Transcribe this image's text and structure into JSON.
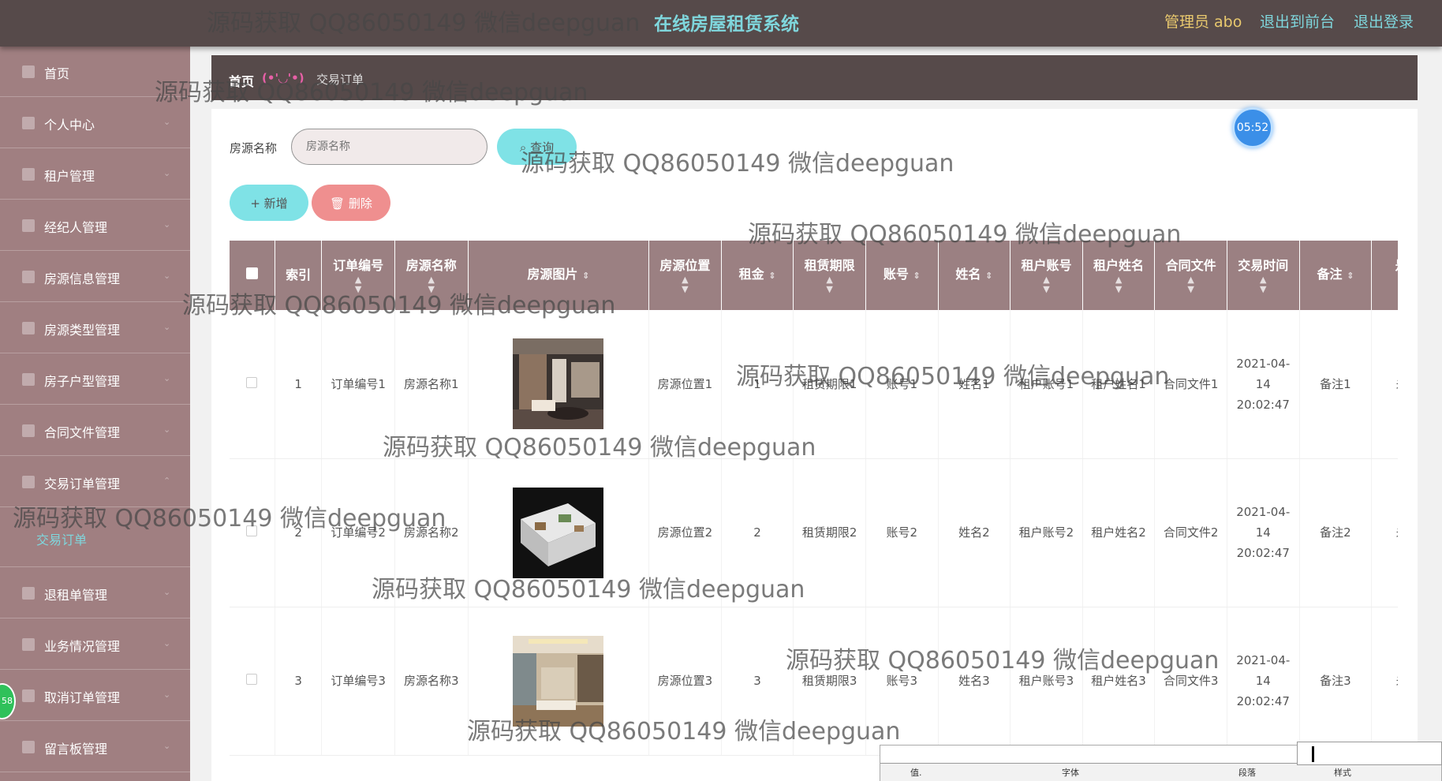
{
  "topbar": {
    "title": "在线房屋租赁系统",
    "admin": "管理员 abo",
    "front": "退出到前台",
    "logout": "退出登录"
  },
  "sidebar": {
    "items": [
      {
        "label": "首页",
        "icon": "home-icon"
      },
      {
        "label": "个人中心",
        "icon": "user-icon"
      },
      {
        "label": "租户管理",
        "icon": "tenant-icon"
      },
      {
        "label": "经纪人管理",
        "icon": "agent-icon"
      },
      {
        "label": "房源信息管理",
        "icon": "house-icon"
      },
      {
        "label": "房源类型管理",
        "icon": "type-icon"
      },
      {
        "label": "房子户型管理",
        "icon": "layout-icon"
      },
      {
        "label": "合同文件管理",
        "icon": "contract-icon"
      },
      {
        "label": "交易订单管理",
        "icon": "order-icon"
      },
      {
        "label": "退租单管理",
        "icon": "flag-icon"
      },
      {
        "label": "业务情况管理",
        "icon": "grid-icon"
      },
      {
        "label": "取消订单管理",
        "icon": "cancel-icon"
      },
      {
        "label": "留言板管理",
        "icon": "message-icon"
      }
    ],
    "active_sub": "交易订单"
  },
  "breadcrumb": {
    "home": "首页",
    "separator": "(•'◡'•)",
    "current": "交易订单"
  },
  "search": {
    "label": "房源名称",
    "placeholder": "房源名称",
    "query": "查询"
  },
  "actions": {
    "add": "+ 新增",
    "delete": "删除"
  },
  "timer": "05:52",
  "table": {
    "headers": [
      "索引",
      "订单编号",
      "房源名称",
      "房源图片",
      "房源位置",
      "租金",
      "租赁期限",
      "账号",
      "姓名",
      "租户账号",
      "租户姓名",
      "合同文件",
      "交易时间",
      "备注",
      "是否"
    ],
    "rows": [
      {
        "index": "1",
        "order_no": "订单编号1",
        "name": "房源名称1",
        "location": "房源位置1",
        "rent": "1",
        "term": "租赁期限1",
        "account": "账号1",
        "person": "姓名1",
        "tenant_account": "租户账号1",
        "tenant_name": "租户姓名1",
        "contract": "合同文件1",
        "time": "2021-04-14 20:02:47",
        "remark": "备注1",
        "status": "未支"
      },
      {
        "index": "2",
        "order_no": "订单编号2",
        "name": "房源名称2",
        "location": "房源位置2",
        "rent": "2",
        "term": "租赁期限2",
        "account": "账号2",
        "person": "姓名2",
        "tenant_account": "租户账号2",
        "tenant_name": "租户姓名2",
        "contract": "合同文件2",
        "time": "2021-04-14 20:02:47",
        "remark": "备注2",
        "status": "未支"
      },
      {
        "index": "3",
        "order_no": "订单编号3",
        "name": "房源名称3",
        "location": "房源位置3",
        "rent": "3",
        "term": "租赁期限3",
        "account": "账号3",
        "person": "姓名3",
        "tenant_account": "租户账号3",
        "tenant_name": "租户姓名3",
        "contract": "合同文件3",
        "time": "2021-04-14 20:02:47",
        "remark": "备注3",
        "status": "未支"
      }
    ]
  },
  "watermark": "源码获取 QQ86050149 微信deepguan",
  "overlay": {
    "badge": "58",
    "toolbar_labels": [
      "值.",
      "字体",
      "段落",
      "样式"
    ]
  },
  "colors": {
    "topbar": "#564a4a",
    "sidebar": "#a07f81",
    "accent": "#7fd6dc",
    "header": "#9b8082",
    "delete": "#ef8f8f"
  }
}
